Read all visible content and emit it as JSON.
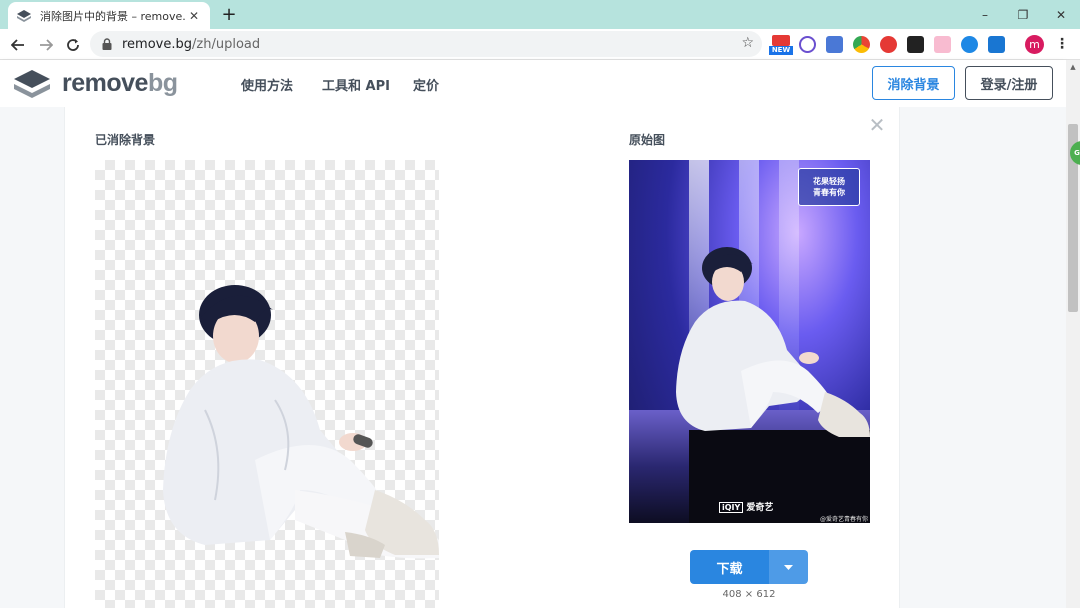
{
  "browser": {
    "tab_title": "消除图片中的背景 – remove.bg",
    "tab_close": "✕",
    "new_tab": "+",
    "url_host": "remove.bg",
    "url_path": "/zh/upload",
    "ext_new_label": "NEW",
    "avatar_letter": "m",
    "window_controls": {
      "minimize": "–",
      "restore": "❐",
      "close": "✕"
    }
  },
  "site": {
    "logo_word_main": "remove",
    "logo_word_bg": "bg",
    "nav": [
      "使用方法",
      "工具和 API",
      "定价"
    ],
    "btn_remove_bg": "消除背景",
    "btn_login": "登录/注册"
  },
  "upload": {
    "result_label": "已消除背景",
    "original_label": "原始图",
    "close_glyph": "✕",
    "download_label": "下载",
    "dimensions": "408 × 612",
    "watermark_top_line1": "花果轻扬",
    "watermark_top_line2": "青春有你",
    "watermark_bottom": "爱奇艺",
    "watermark_weibo": "@爱奇艺青春有你"
  },
  "colors": {
    "accent": "#2a86e0",
    "brand_text": "#454f5b",
    "tabstrip": "#b6e3dd"
  }
}
